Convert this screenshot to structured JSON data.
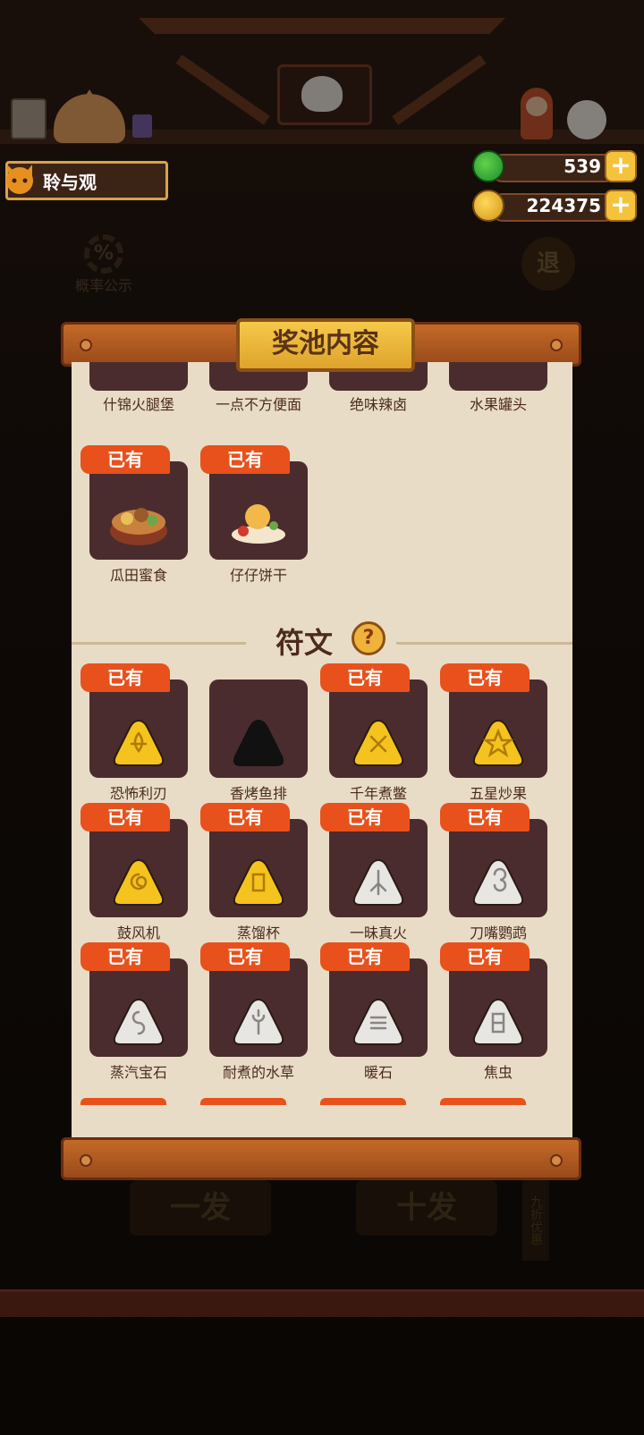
{
  "player": {
    "name": "聆与观"
  },
  "currency": {
    "gems": "539",
    "coins": "224375"
  },
  "background": {
    "probability_label": "概率公示",
    "probability_icon": "%",
    "exit_label": "退",
    "single_draw": "一发",
    "ten_draw": "十发",
    "discount": "九折优惠"
  },
  "panel": {
    "title": "奖池内容",
    "badge_owned": "已有",
    "foods_top_row": [
      "什锦火腿堡",
      "一点不方便面",
      "绝味辣卤",
      "水果罐头"
    ],
    "foods": [
      {
        "name": "瓜田蜜食",
        "owned": true
      },
      {
        "name": "仔仔饼干",
        "owned": true
      }
    ],
    "rune_section": {
      "title": "符文",
      "help_icon": "?"
    },
    "runes": [
      {
        "name": "恐怖利刃",
        "owned": true,
        "color": "gold"
      },
      {
        "name": "香烤鱼排",
        "owned": false,
        "color": "black"
      },
      {
        "name": "千年煮鳖",
        "owned": true,
        "color": "gold"
      },
      {
        "name": "五星炒果",
        "owned": true,
        "color": "gold"
      },
      {
        "name": "鼓风机",
        "owned": true,
        "color": "gold"
      },
      {
        "name": "蒸馏杯",
        "owned": true,
        "color": "gold"
      },
      {
        "name": "一昧真火",
        "owned": true,
        "color": "white"
      },
      {
        "name": "刀嘴鹦鹉",
        "owned": true,
        "color": "white"
      },
      {
        "name": "蒸汽宝石",
        "owned": true,
        "color": "white"
      },
      {
        "name": "耐煮的水草",
        "owned": true,
        "color": "white"
      },
      {
        "name": "暖石",
        "owned": true,
        "color": "white"
      },
      {
        "name": "焦虫",
        "owned": true,
        "color": "white"
      }
    ]
  },
  "colors": {
    "badge": "#e8511c",
    "card": "#4a2c2e",
    "paper": "#e9dcc6",
    "rune_gold": "#f4c31d",
    "rune_white": "#e8e6e2"
  }
}
